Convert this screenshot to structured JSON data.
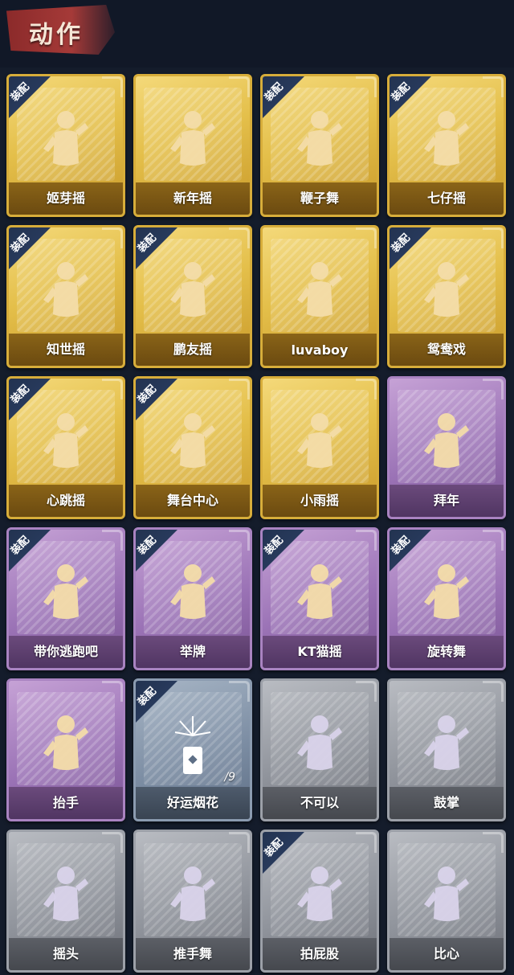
{
  "header": {
    "title": "动作"
  },
  "badge_label": "装配",
  "colors": {
    "gold": "#e4bf4a",
    "purple": "#9b73b6",
    "bluegrey": "#7d8ea4",
    "grey": "#8f939b",
    "badge": "#22324f",
    "background": "#141c2b"
  },
  "cards": [
    {
      "label": "姬芽摇",
      "tier": "gold",
      "equipped": true,
      "icon": "dance-figure-icon"
    },
    {
      "label": "新年摇",
      "tier": "gold",
      "equipped": false,
      "icon": "dance-figure-icon"
    },
    {
      "label": "鞭子舞",
      "tier": "gold",
      "equipped": true,
      "icon": "dance-figure-icon"
    },
    {
      "label": "七仔摇",
      "tier": "gold",
      "equipped": true,
      "icon": "dance-figure-icon"
    },
    {
      "label": "知世摇",
      "tier": "gold",
      "equipped": true,
      "icon": "dance-figure-icon"
    },
    {
      "label": "鹏友摇",
      "tier": "gold",
      "equipped": true,
      "icon": "dance-figure-icon"
    },
    {
      "label": "luvaboy",
      "tier": "gold",
      "equipped": false,
      "icon": "dance-figure-icon"
    },
    {
      "label": "鸳鸯戏",
      "tier": "gold",
      "equipped": true,
      "icon": "dance-figure-icon"
    },
    {
      "label": "心跳摇",
      "tier": "gold",
      "equipped": true,
      "icon": "dance-figure-icon"
    },
    {
      "label": "舞台中心",
      "tier": "gold",
      "equipped": true,
      "icon": "dance-figure-icon"
    },
    {
      "label": "小雨摇",
      "tier": "gold",
      "equipped": false,
      "icon": "dance-figure-icon"
    },
    {
      "label": "拜年",
      "tier": "purple",
      "equipped": false,
      "icon": "bow-figure-icon"
    },
    {
      "label": "带你逃跑吧",
      "tier": "purple",
      "equipped": true,
      "icon": "dance-figure-icon"
    },
    {
      "label": "举牌",
      "tier": "purple",
      "equipped": true,
      "icon": "sign-figure-icon"
    },
    {
      "label": "KT猫摇",
      "tier": "purple",
      "equipped": true,
      "icon": "dance-figure-icon"
    },
    {
      "label": "旋转舞",
      "tier": "purple",
      "equipped": true,
      "icon": "spin-figure-icon"
    },
    {
      "label": "抬手",
      "tier": "purple",
      "equipped": false,
      "icon": "raise-hand-figure-icon"
    },
    {
      "label": "好运烟花",
      "tier": "bluegrey",
      "equipped": true,
      "icon": "firework-icon",
      "count": "/9"
    },
    {
      "label": "不可以",
      "tier": "grey",
      "equipped": false,
      "icon": "finger-wag-icon"
    },
    {
      "label": "鼓掌",
      "tier": "grey",
      "equipped": false,
      "icon": "clap-icon"
    },
    {
      "label": "摇头",
      "tier": "grey",
      "equipped": false,
      "icon": "shake-head-figure-icon"
    },
    {
      "label": "推手舞",
      "tier": "grey",
      "equipped": false,
      "icon": "push-dance-figure-icon"
    },
    {
      "label": "拍屁股",
      "tier": "grey",
      "equipped": true,
      "icon": "slap-figure-icon"
    },
    {
      "label": "比心",
      "tier": "grey",
      "equipped": false,
      "icon": "heart-hand-icon"
    }
  ]
}
